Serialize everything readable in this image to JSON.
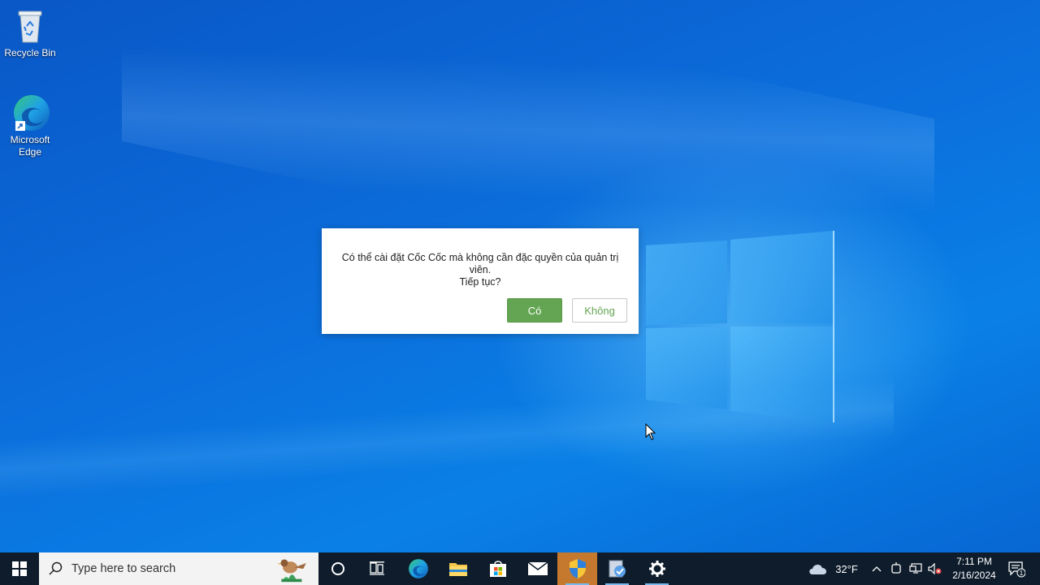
{
  "desktop": {
    "icons": [
      {
        "label": "Recycle Bin",
        "icon": "recycle-bin-icon"
      },
      {
        "label": "Microsoft\nEdge",
        "icon": "edge-icon"
      }
    ]
  },
  "dialog": {
    "message_line1": "Có thể cài đặt Cốc Cốc mà không cần đặc quyền của quản trị viên.",
    "message_line2": "Tiếp tục?",
    "yes_label": "Có",
    "no_label": "Không"
  },
  "taskbar": {
    "search_placeholder": "Type here to search",
    "apps": [
      "edge-icon",
      "file-explorer-icon",
      "store-icon",
      "mail-icon",
      "installer-shield-icon",
      "setup-app-icon",
      "settings-gear-icon"
    ],
    "weather": {
      "temp": "32°F",
      "icon": "cloud-icon"
    },
    "clock": {
      "time": "7:11 PM",
      "date": "2/16/2024"
    },
    "notifications_count": "1"
  },
  "colors": {
    "accent_green": "#63a552",
    "taskbar_bg": "#0e1c2b",
    "desktop_blue": "#0b6fdc"
  }
}
